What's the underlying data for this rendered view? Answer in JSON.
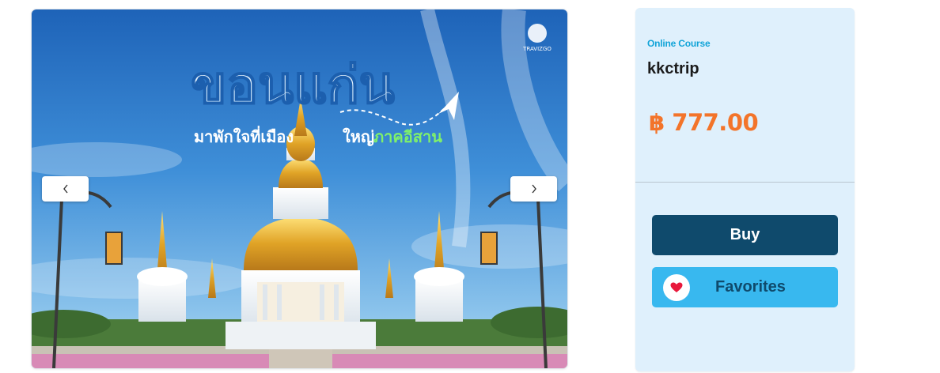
{
  "carousel": {
    "headline": "ขอนแก่น",
    "tagline_part1": "มาพักใจที่เมือง",
    "tagline_part2": "ใหญ่",
    "tagline_highlight": "ภาคอีสาน",
    "logo_text": "TRAVIZGO",
    "prev_icon": "chevron-left-icon",
    "next_icon": "chevron-right-icon"
  },
  "product": {
    "category": "Online Course",
    "title": "kkctrip",
    "price": "฿ 777.00"
  },
  "actions": {
    "buy_label": "Buy",
    "favorites_label": "Favorites",
    "favorites_icon": "heart-icon"
  },
  "colors": {
    "accent_dark": "#0f4a6c",
    "accent_light": "#38b8ef",
    "category": "#12a4d8",
    "price": "#f3742a",
    "heart": "#e8193c",
    "card_bg": "#dff0fc"
  }
}
